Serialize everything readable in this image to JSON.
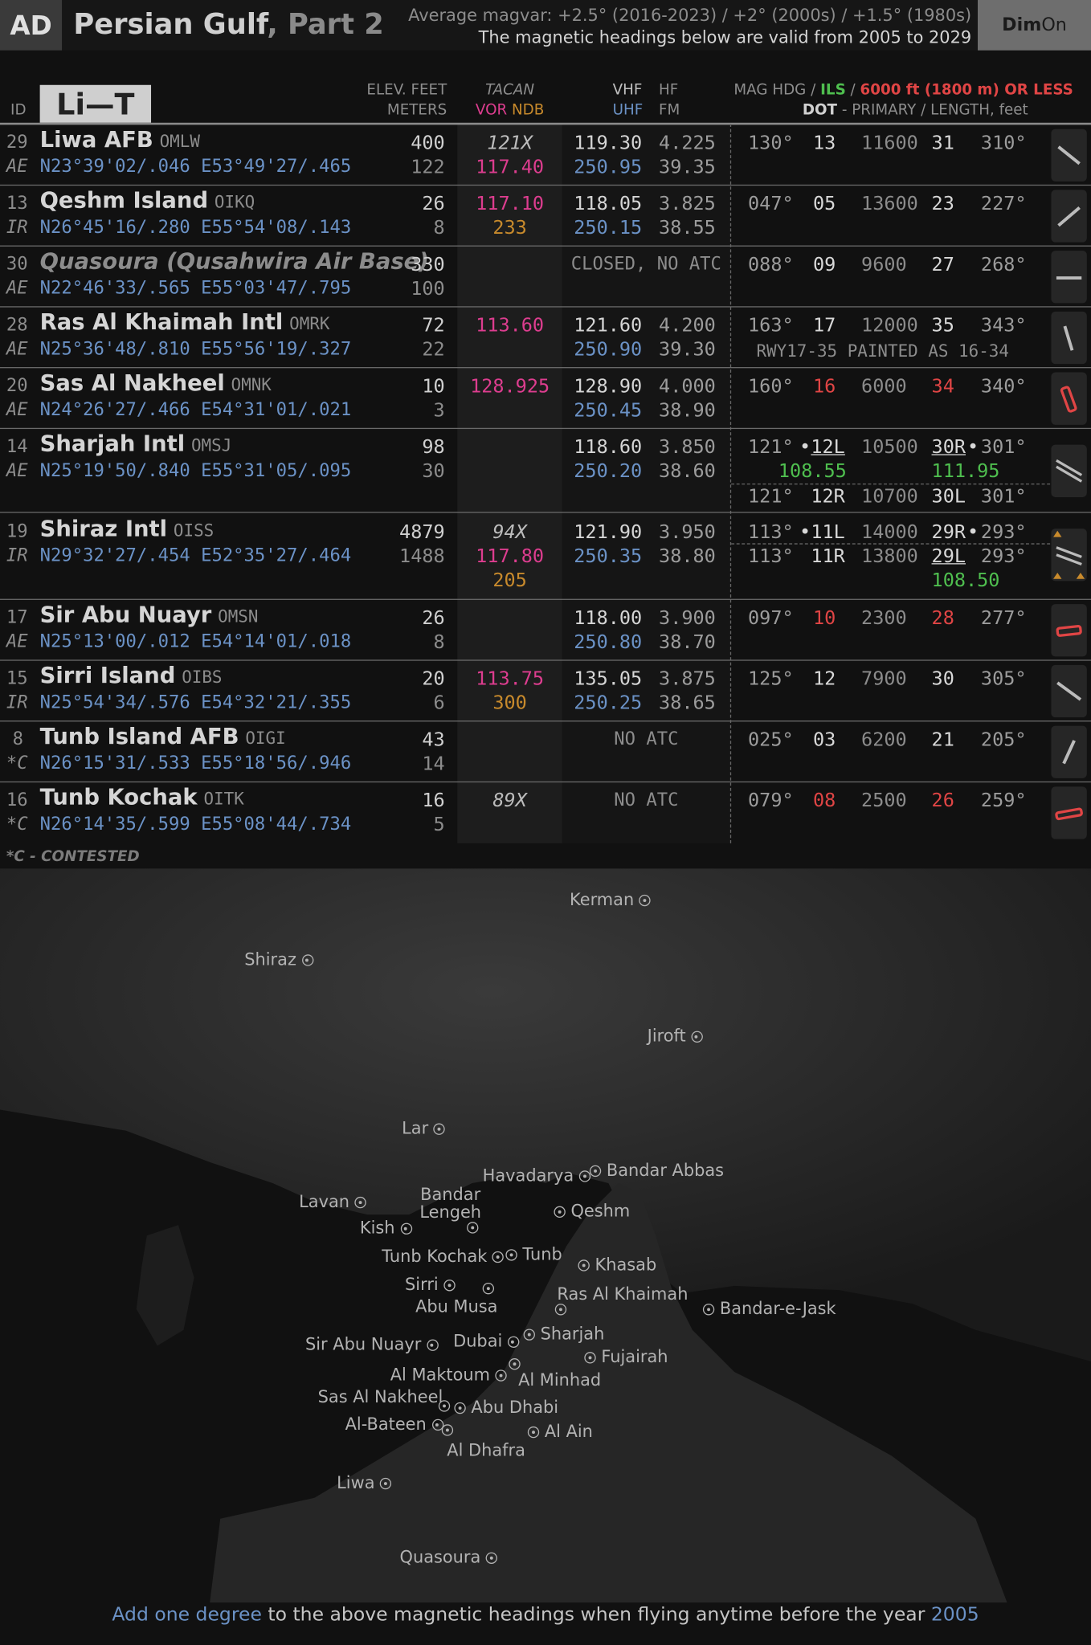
{
  "header": {
    "id": "AD",
    "title": "Persian Gulf",
    "part": ", Part 2",
    "magvar": "Average magvar: +2.5° (2016-2023) / +2° (2000s) / +1.5° (1980s)",
    "valid": "The magnetic headings below are valid from 2005 to 2029",
    "dim": "Dim",
    "on": "On"
  },
  "columns": {
    "id": "ID",
    "range": "Li—T",
    "elev_feet": "ELEV. FEET",
    "elev_meters": "METERS",
    "tacan": "TACAN",
    "vor": "VOR",
    "ndb": "NDB",
    "vhf": "VHF",
    "uhf": "UHF",
    "hf": "HF",
    "fm": "FM",
    "mag_hdg": "MAG HDG",
    "ils": "ILS",
    "limit": "6000 ft (1800 m) OR LESS",
    "dot": "DOT",
    "primary": "- PRIMARY / LENGTH, feet"
  },
  "airports": [
    {
      "id": "29",
      "country": "AE",
      "name": "Liwa AFB",
      "icao": "OMLW",
      "coords": "N23°39'02/.046 E53°49'27/.465",
      "elev_ft": "400",
      "elev_m": "122",
      "tacan": "121X",
      "vor": "117.40",
      "ndb": "",
      "vhf": "119.30",
      "uhf": "250.95",
      "hf": "4.225",
      "fm": "39.35",
      "rwy": {
        "hdg1": "130°",
        "r1": "13",
        "len": "11600",
        "r2": "31",
        "hdg2": "310°"
      }
    },
    {
      "id": "13",
      "country": "IR",
      "name": "Qeshm Island",
      "icao": "OIKQ",
      "coords": "N26°45'16/.280 E55°54'08/.143",
      "elev_ft": "26",
      "elev_m": "8",
      "tacan": "",
      "vor": "117.10",
      "ndb": "233",
      "vhf": "118.05",
      "uhf": "250.15",
      "hf": "3.825",
      "fm": "38.55",
      "rwy": {
        "hdg1": "047°",
        "r1": "05",
        "len": "13600",
        "r2": "23",
        "hdg2": "227°"
      }
    },
    {
      "id": "30",
      "country": "AE",
      "name": "Quasoura (Qusahwira Air Base)",
      "icao": "",
      "coords": "N22°46'33/.565 E55°03'47/.795",
      "elev_ft": "330",
      "elev_m": "100",
      "atc": "CLOSED, NO ATC",
      "rwy": {
        "hdg1": "088°",
        "r1": "09",
        "len": "9600",
        "r2": "27",
        "hdg2": "268°"
      }
    },
    {
      "id": "28",
      "country": "AE",
      "name": "Ras Al Khaimah Intl",
      "icao": "OMRK",
      "coords": "N25°36'48/.810 E55°56'19/.327",
      "elev_ft": "72",
      "elev_m": "22",
      "tacan": "",
      "vor": "113.60",
      "ndb": "",
      "vhf": "121.60",
      "uhf": "250.90",
      "hf": "4.200",
      "fm": "39.30",
      "rwy": {
        "hdg1": "163°",
        "r1": "17",
        "len": "12000",
        "r2": "35",
        "hdg2": "343°",
        "note": "RWY17-35 PAINTED AS 16-34"
      }
    },
    {
      "id": "20",
      "country": "AE",
      "name": "Sas Al Nakheel",
      "icao": "OMNK",
      "coords": "N24°26'27/.466 E54°31'01/.021",
      "elev_ft": "10",
      "elev_m": "3",
      "tacan": "",
      "vor": "128.925",
      "ndb": "",
      "vhf": "128.90",
      "uhf": "250.45",
      "hf": "4.000",
      "fm": "38.90",
      "rwy": {
        "hdg1": "160°",
        "r1": "16",
        "len": "6000",
        "r2": "34",
        "hdg2": "340°"
      }
    },
    {
      "id": "14",
      "country": "AE",
      "name": "Sharjah Intl",
      "icao": "OMSJ",
      "coords": "N25°19'50/.840 E55°31'05/.095",
      "elev_ft": "98",
      "elev_m": "30",
      "vhf": "118.60",
      "uhf": "250.20",
      "hf": "3.850",
      "fm": "38.60",
      "rwy": {
        "hdg1": "121°",
        "dot1": "•",
        "r1": "12L",
        "ils1": "108.55",
        "len": "10500",
        "r2": "30R",
        "dot2": "•",
        "ils2": "111.95",
        "hdg2": "301°",
        "hdg1b": "121°",
        "r1b": "12R",
        "lenb": "10700",
        "r2b": "30L",
        "hdg2b": "301°"
      }
    },
    {
      "id": "19",
      "country": "IR",
      "name": "Shiraz Intl",
      "icao": "OISS",
      "coords": "N29°32'27/.454 E52°35'27/.464",
      "elev_ft": "4879",
      "elev_m": "1488",
      "tacan": "94X",
      "vor": "117.80",
      "ndb": "205",
      "vhf": "121.90",
      "uhf": "250.35",
      "hf": "3.950",
      "fm": "38.80",
      "rwy": {
        "hdg1": "113°",
        "dot1": "•",
        "r1": "11L",
        "len": "14000",
        "r2": "29R",
        "dot2": "•",
        "hdg2": "293°",
        "hdg1b": "113°",
        "r1b": "11R",
        "lenb": "13800",
        "r2b": "29L",
        "hdg2b": "293°",
        "ils2b": "108.50"
      }
    },
    {
      "id": "17",
      "country": "AE",
      "name": "Sir Abu Nuayr",
      "icao": "OMSN",
      "coords": "N25°13'00/.012 E54°14'01/.018",
      "elev_ft": "26",
      "elev_m": "8",
      "vhf": "118.00",
      "uhf": "250.80",
      "hf": "3.900",
      "fm": "38.70",
      "rwy": {
        "hdg1": "097°",
        "r1": "10",
        "len": "2300",
        "r2": "28",
        "hdg2": "277°"
      }
    },
    {
      "id": "15",
      "country": "IR",
      "name": "Sirri Island",
      "icao": "OIBS",
      "coords": "N25°54'34/.576 E54°32'21/.355",
      "elev_ft": "20",
      "elev_m": "6",
      "vor": "113.75",
      "ndb": "300",
      "vhf": "135.05",
      "uhf": "250.25",
      "hf": "3.875",
      "fm": "38.65",
      "rwy": {
        "hdg1": "125°",
        "r1": "12",
        "len": "7900",
        "r2": "30",
        "hdg2": "305°"
      }
    },
    {
      "id": "8",
      "country": "*C",
      "name": "Tunb Island AFB",
      "icao": "OIGI",
      "coords": "N26°15'31/.533 E55°18'56/.946",
      "elev_ft": "43",
      "elev_m": "14",
      "atc": "NO ATC",
      "rwy": {
        "hdg1": "025°",
        "r1": "03",
        "len": "6200",
        "r2": "21",
        "hdg2": "205°"
      }
    },
    {
      "id": "16",
      "country": "*C",
      "name": "Tunb Kochak",
      "icao": "OITK",
      "coords": "N26°14'35/.599 E55°08'44/.734",
      "elev_ft": "16",
      "elev_m": "5",
      "tacan": "89X",
      "atc": "NO ATC",
      "rwy": {
        "hdg1": "079°",
        "r1": "08",
        "len": "2500",
        "r2": "26",
        "hdg2": "259°"
      }
    }
  ],
  "footnote": "*C - CONTESTED",
  "map": {
    "cities": [
      "Kerman",
      "Shiraz",
      "Jiroft",
      "Lar",
      "Havadarya",
      "Bandar Abbas",
      "Lavan",
      "Bandar",
      "Lengeh",
      "Qeshm",
      "Kish",
      "Tunb Kochak",
      "Tunb",
      "Khasab",
      "Sirri",
      "Abu Musa",
      "Ras Al Khaimah",
      "Bandar-e-Jask",
      "Sharjah",
      "Sir Abu Nuayr",
      "Dubai",
      "Fujairah",
      "Al Maktoum",
      "Al Minhad",
      "Sas Al Nakheel",
      "Abu Dhabi",
      "Al-Bateen",
      "Al Ain",
      "Al Dhafra",
      "Liwa",
      "Quasoura"
    ]
  },
  "bottom": {
    "pre": "Add one degree",
    "mid": " to the above magnetic headings when flying anytime before the year ",
    "year": "2005"
  },
  "colors": {
    "coords": "#6b92c6",
    "vor": "#dd3d8f",
    "ndb": "#c88a2c",
    "ils": "#4fbf4f",
    "red": "#e04545"
  }
}
